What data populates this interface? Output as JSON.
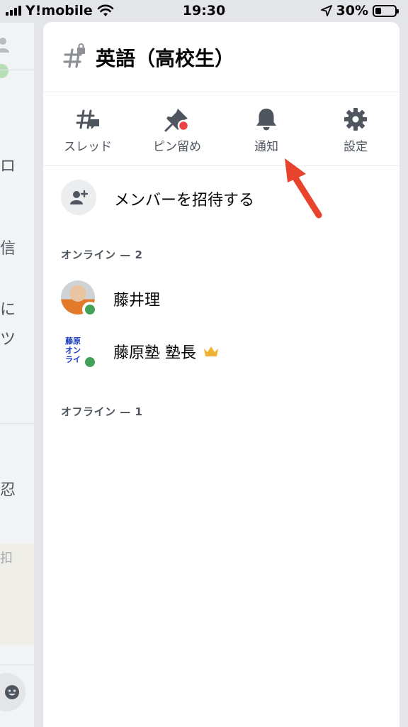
{
  "status_bar": {
    "carrier": "Y!mobile",
    "time": "19:30",
    "battery": "30%",
    "battery_level": 0.3
  },
  "background": {
    "fragments": [
      "ロ",
      "信",
      "に",
      "ツ",
      "忍",
      "扣"
    ]
  },
  "channel": {
    "title": "英語（高校生）",
    "icon": "hashtag-lock-icon"
  },
  "actions": [
    {
      "label": "スレッド",
      "icon": "threads-icon"
    },
    {
      "label": "ピン留め",
      "icon": "pin-icon"
    },
    {
      "label": "通知",
      "icon": "bell-icon"
    },
    {
      "label": "設定",
      "icon": "gear-icon"
    }
  ],
  "invite": {
    "label": "メンバーを招待する",
    "icon": "add-member-icon"
  },
  "sections": {
    "online": "オンライン — 2",
    "offline": "オフライン — 1"
  },
  "members": [
    {
      "name": "藤井理",
      "status": "online",
      "status_color": "#43a25a",
      "owner": false
    },
    {
      "name": "藤原塾 塾長",
      "status": "online",
      "status_color": "#43a25a",
      "owner": true,
      "avatar_text": [
        "藤原",
        "オン",
        "ライ"
      ]
    }
  ],
  "colors": {
    "accent_arrow": "#e8432c",
    "online": "#43a25a",
    "crown": "#f0b232",
    "pin_dot": "#ed4245"
  }
}
